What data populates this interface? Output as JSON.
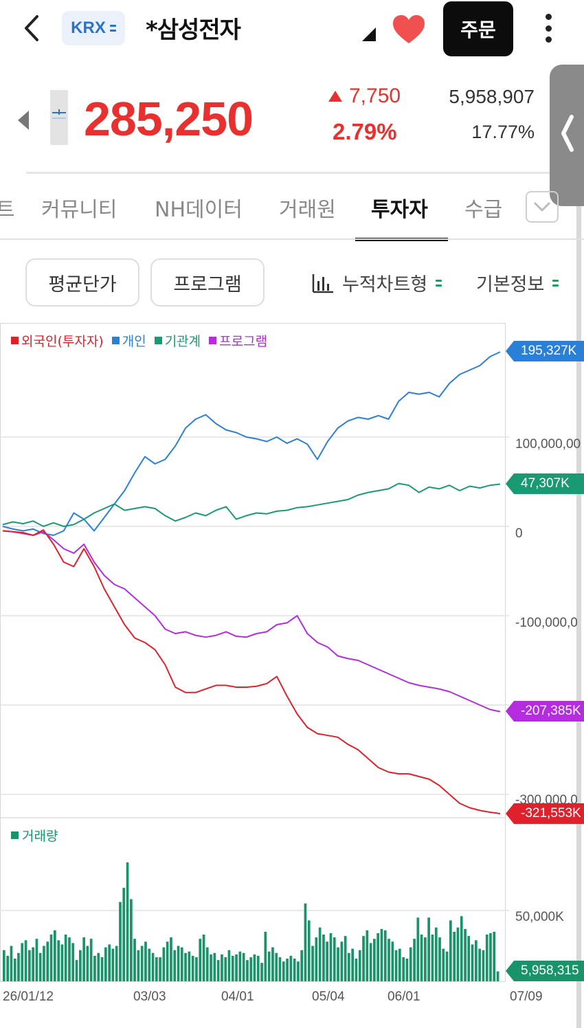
{
  "header": {
    "market": "KRX",
    "stock_name": "*삼성전자",
    "order_label": "주문"
  },
  "quote": {
    "price": "285,250",
    "change": "7,750",
    "change_pct": "2.79%",
    "volume": "5,958,907",
    "turnover_pct": "17.77%"
  },
  "tabs": [
    {
      "label": "트",
      "active": false
    },
    {
      "label": "커뮤니티",
      "active": false
    },
    {
      "label": "NH데이터",
      "active": false
    },
    {
      "label": "거래원",
      "active": false
    },
    {
      "label": "투자자",
      "active": true
    },
    {
      "label": "수급",
      "active": false
    }
  ],
  "filters": {
    "avg_price": "평균단가",
    "program": "프로그램",
    "chart_type": "누적차트형",
    "basic_info": "기본정보"
  },
  "colors": {
    "up": "#e8312f",
    "foreign": "#e0202a",
    "individual": "#2a7fd6",
    "institution": "#1a9a72",
    "program": "#b42be0",
    "volume": "#19936a"
  },
  "chart_data": {
    "type": "line",
    "legend": [
      "외국인(투자자)",
      "개인",
      "기관계",
      "프로그램"
    ],
    "x_ticks": [
      "26/01/12",
      "03/03",
      "04/01",
      "05/04",
      "06/01",
      "07/09"
    ],
    "y_ticks": [
      "100,000,00",
      "0",
      "-100,000,0",
      "-300,000,0"
    ],
    "ylim": [
      -320000,
      200000
    ],
    "last_values": {
      "개인": "195,327K",
      "기관계": "47,307K",
      "프로그램": "-207,385K",
      "외국인(투자자)": "-321,553K"
    },
    "series": [
      {
        "name": "개인",
        "values": [
          0,
          -3000,
          -5000,
          -3000,
          -8000,
          -10000,
          -5000,
          15000,
          8000,
          -5000,
          10000,
          25000,
          40000,
          60000,
          78000,
          70000,
          75000,
          90000,
          110000,
          120000,
          125000,
          115000,
          108000,
          105000,
          100000,
          98000,
          95000,
          100000,
          93000,
          98000,
          92000,
          75000,
          95000,
          110000,
          118000,
          122000,
          120000,
          124000,
          120000,
          140000,
          150000,
          148000,
          150000,
          145000,
          160000,
          170000,
          175000,
          180000,
          190000,
          195327
        ]
      },
      {
        "name": "기관계",
        "values": [
          2000,
          5000,
          3000,
          6000,
          0,
          4000,
          0,
          2000,
          8000,
          15000,
          20000,
          25000,
          18000,
          20000,
          22000,
          20000,
          12000,
          6000,
          10000,
          15000,
          12000,
          18000,
          22000,
          8000,
          12000,
          15000,
          14000,
          17000,
          18000,
          21000,
          22000,
          24000,
          26000,
          28000,
          30000,
          35000,
          38000,
          40000,
          42000,
          48000,
          46000,
          38000,
          44000,
          42000,
          46000,
          40000,
          45000,
          43000,
          46000,
          47307
        ]
      },
      {
        "name": "프로그램",
        "values": [
          -5000,
          -6000,
          -8000,
          -10000,
          -6000,
          -15000,
          -25000,
          -30000,
          -20000,
          -40000,
          -55000,
          -65000,
          -70000,
          -80000,
          -90000,
          -100000,
          -115000,
          -120000,
          -118000,
          -122000,
          -124000,
          -122000,
          -118000,
          -123000,
          -124000,
          -120000,
          -118000,
          -110000,
          -108000,
          -100000,
          -120000,
          -130000,
          -135000,
          -145000,
          -148000,
          -150000,
          -155000,
          -160000,
          -165000,
          -170000,
          -175000,
          -178000,
          -180000,
          -182000,
          -185000,
          -190000,
          -195000,
          -200000,
          -205000,
          -207385
        ]
      },
      {
        "name": "외국인(투자자)",
        "values": [
          -5000,
          -6000,
          -7000,
          -10000,
          -4000,
          -20000,
          -40000,
          -45000,
          -25000,
          -45000,
          -70000,
          -90000,
          -110000,
          -125000,
          -130000,
          -138000,
          -155000,
          -180000,
          -186000,
          -186000,
          -182000,
          -178000,
          -178000,
          -180000,
          -180000,
          -179000,
          -176000,
          -168000,
          -190000,
          -210000,
          -225000,
          -232000,
          -234000,
          -236000,
          -244000,
          -250000,
          -260000,
          -270000,
          -275000,
          -277000,
          -277000,
          -280000,
          -283000,
          -290000,
          -300000,
          -310000,
          -315000,
          -318000,
          -320000,
          -321553
        ]
      }
    ],
    "volume": {
      "name": "거래량",
      "label_50k": "50,000K",
      "last": "5,958,315",
      "values": [
        22000,
        18000,
        25000,
        16000,
        20000,
        27000,
        29000,
        22000,
        24000,
        30000,
        20000,
        25000,
        28000,
        33000,
        36000,
        29000,
        26000,
        33000,
        31000,
        27000,
        15000,
        22000,
        31000,
        25000,
        30000,
        18000,
        20000,
        17000,
        24000,
        26000,
        23000,
        25000,
        56000,
        66000,
        84000,
        58000,
        30000,
        22000,
        25000,
        28000,
        23000,
        20000,
        17000,
        17000,
        24000,
        28000,
        31000,
        22000,
        25000,
        24000,
        20000,
        21000,
        18000,
        17000,
        30000,
        33000,
        24000,
        19000,
        20000,
        15000,
        19000,
        17000,
        22000,
        18000,
        19000,
        21000,
        20000,
        15000,
        17000,
        19000,
        18000,
        13000,
        35000,
        21000,
        24000,
        20000,
        17000,
        14000,
        16000,
        18000,
        16000,
        14000,
        22000,
        55000,
        43000,
        25000,
        31000,
        38000,
        33000,
        28000,
        34000,
        31000,
        24000,
        28000,
        32000,
        20000,
        23000,
        16000,
        22000,
        32000,
        36000,
        27000,
        30000,
        34000,
        37000,
        36000,
        30000,
        28000,
        22000,
        23000,
        17000,
        16000,
        24000,
        30000,
        45000,
        33000,
        31000,
        45000,
        33000,
        38000,
        31000,
        23000,
        21000,
        43000,
        35000,
        38000,
        46000,
        37000,
        32000,
        26000,
        29000,
        23000,
        22000,
        33000,
        34000,
        35000,
        7000
      ]
    }
  }
}
